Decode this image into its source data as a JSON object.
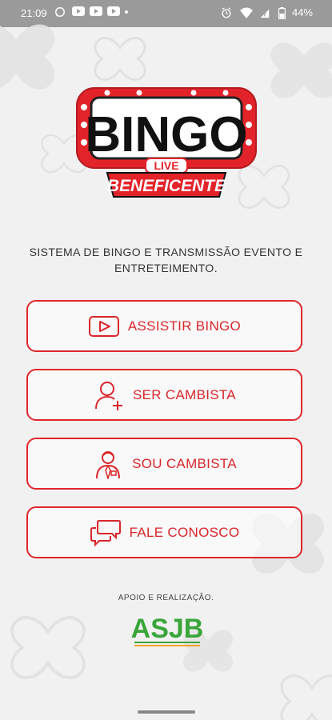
{
  "status_bar": {
    "time": "21:09",
    "battery": "44%"
  },
  "logo": {
    "word": "BINGO",
    "badge": "LIVE",
    "banner": "BENEFICENTE"
  },
  "tagline": "SISTEMA DE BINGO E TRANSMISSÃO EVENTO E ENTRETEIMENTO.",
  "buttons": [
    {
      "label": "ASSISTIR BINGO",
      "icon": "play-icon"
    },
    {
      "label": "SER CAMBISTA",
      "icon": "add-user-icon"
    },
    {
      "label": "SOU CAMBISTA",
      "icon": "person-badge-icon"
    },
    {
      "label": "FALE CONOSCO",
      "icon": "chat-bubbles-icon"
    }
  ],
  "footer": {
    "support_label": "APOIO E REALIZAÇÃO.",
    "sponsor_logo": "ASJB"
  },
  "colors": {
    "accent": "#e0262b",
    "sponsor_green": "#3aa53a"
  }
}
